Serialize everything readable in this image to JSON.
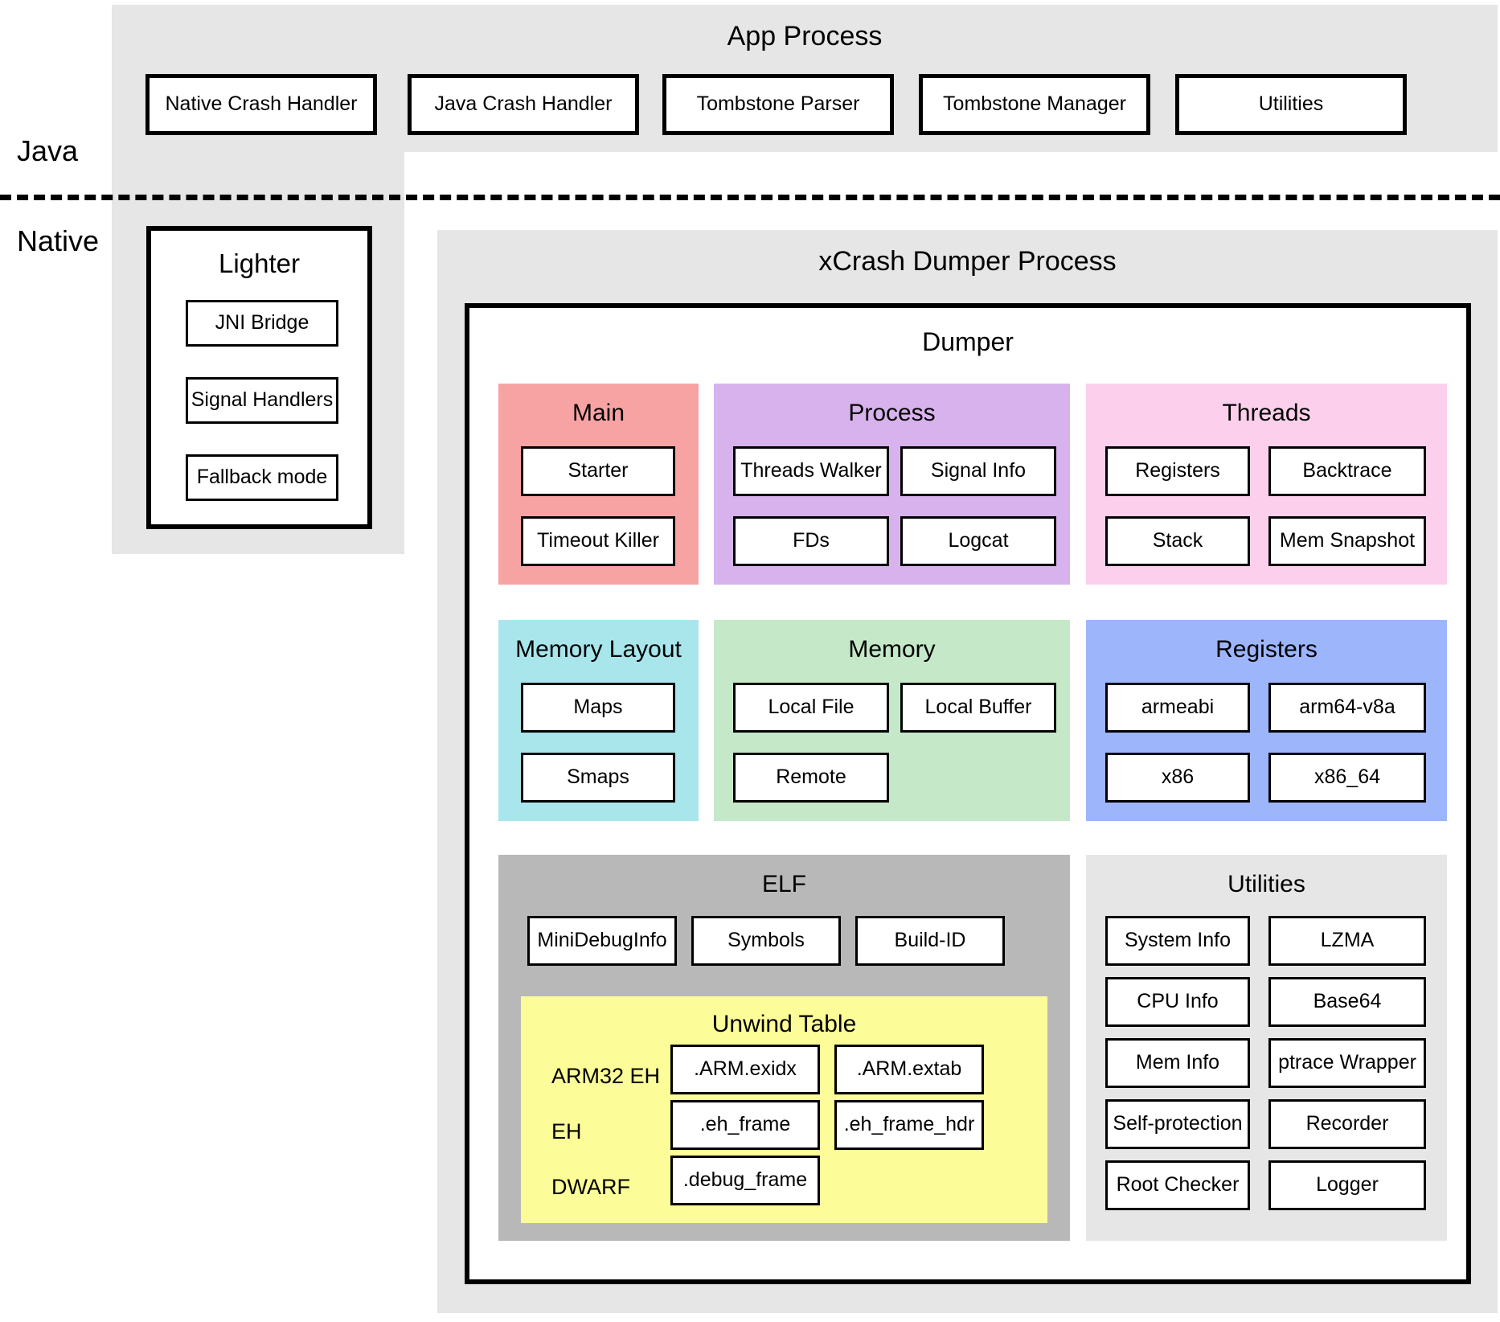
{
  "layers": {
    "java_label": "Java",
    "native_label": "Native"
  },
  "app_process": {
    "title": "App Process",
    "modules": [
      "Native Crash Handler",
      "Java Crash Handler",
      "Tombstone Parser",
      "Tombstone Manager",
      "Utilities"
    ]
  },
  "lighter": {
    "title": "Lighter",
    "modules": [
      "JNI Bridge",
      "Signal Handlers",
      "Fallback mode"
    ]
  },
  "xcrash": {
    "title": "xCrash Dumper Process",
    "dumper_title": "Dumper",
    "groups": {
      "main": {
        "title": "Main",
        "color": "#f8a3a3",
        "items": [
          "Starter",
          "Timeout Killer"
        ]
      },
      "process": {
        "title": "Process",
        "color": "#d8b2ec",
        "items": [
          "Threads Walker",
          "Signal Info",
          "FDs",
          "Logcat"
        ]
      },
      "threads": {
        "title": "Threads",
        "color": "#fcd0ec",
        "items": [
          "Registers",
          "Backtrace",
          "Stack",
          "Mem Snapshot"
        ]
      },
      "memory_layout": {
        "title": "Memory Layout",
        "color": "#a8e6ec",
        "items": [
          "Maps",
          "Smaps"
        ]
      },
      "memory": {
        "title": "Memory",
        "color": "#c5e8c8",
        "items": [
          "Local File",
          "Local Buffer",
          "Remote"
        ]
      },
      "registers": {
        "title": "Registers",
        "color": "#9db5fb",
        "items": [
          "armeabi",
          "arm64-v8a",
          "x86",
          "x86_64"
        ]
      },
      "elf": {
        "title": "ELF",
        "color": "#b8b8b8",
        "items": [
          "MiniDebugInfo",
          "Symbols",
          "Build-ID"
        ],
        "unwind_table": {
          "title": "Unwind Table",
          "color": "#fcfc98",
          "rows": [
            {
              "label": "ARM32 EH",
              "items": [
                ".ARM.exidx",
                ".ARM.extab"
              ]
            },
            {
              "label": "EH",
              "items": [
                ".eh_frame",
                ".eh_frame_hdr"
              ]
            },
            {
              "label": "DWARF",
              "items": [
                ".debug_frame"
              ]
            }
          ]
        }
      },
      "utilities": {
        "title": "Utilities",
        "color": "#e6e6e6",
        "items": [
          "System Info",
          "LZMA",
          "CPU Info",
          "Base64",
          "Mem Info",
          "ptrace Wrapper",
          "Self-protection",
          "Recorder",
          "Root Checker",
          "Logger"
        ]
      }
    }
  }
}
